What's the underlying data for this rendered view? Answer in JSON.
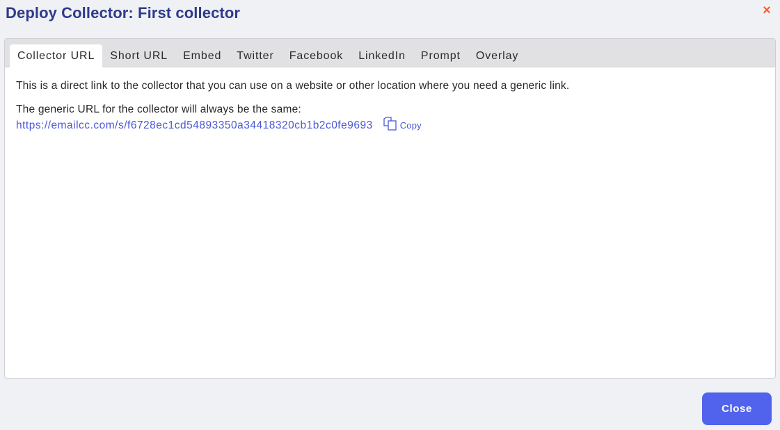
{
  "dialog": {
    "title": "Deploy Collector: First collector",
    "close_icon": "×"
  },
  "tabs": [
    {
      "label": "Collector URL",
      "active": true
    },
    {
      "label": "Short URL",
      "active": false
    },
    {
      "label": "Embed",
      "active": false
    },
    {
      "label": "Twitter",
      "active": false
    },
    {
      "label": "Facebook",
      "active": false
    },
    {
      "label": "LinkedIn",
      "active": false
    },
    {
      "label": "Prompt",
      "active": false
    },
    {
      "label": "Overlay",
      "active": false
    }
  ],
  "content": {
    "description": "This is a direct link to the collector that you can use on a website or other location where you need a generic link.",
    "generic_label": "The generic URL for the collector will always be the same:",
    "url": "https://emailcc.com/s/f6728ec1cd54893350a34418320cb1b2c0fe9693",
    "copy_label": "Copy",
    "copy_icon": "copy-icon"
  },
  "footer": {
    "close_label": "Close"
  },
  "colors": {
    "title": "#2e3a8c",
    "accent": "#5163ec",
    "link": "#4a57d6",
    "close_x": "#f06234"
  }
}
